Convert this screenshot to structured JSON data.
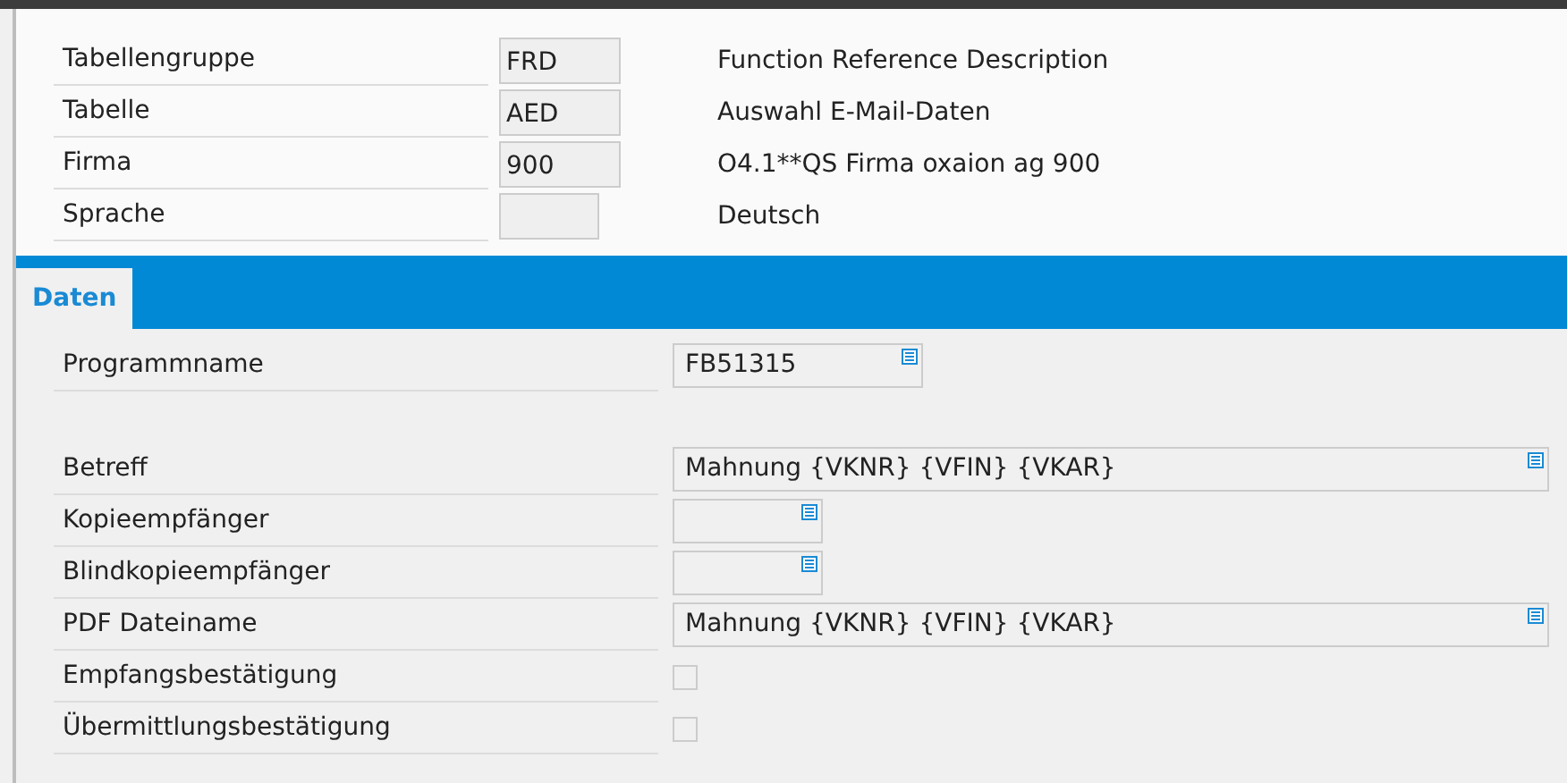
{
  "header_rows": [
    {
      "label": "Tabellengruppe",
      "code": "FRD",
      "description": "Function Reference Description"
    },
    {
      "label": "Tabelle",
      "code": "AED",
      "description": "Auswahl E-Mail-Daten"
    },
    {
      "label": "Firma",
      "code": "900",
      "description": "O4.1**QS Firma oxaion ag 900"
    },
    {
      "label": "Sprache",
      "description": "Deutsch"
    }
  ],
  "tabs": [
    {
      "label": "Daten",
      "selected": true
    }
  ],
  "field_groups": [
    [
      {
        "label": "Programmname",
        "kind": "field",
        "value": "FB51315"
      }
    ],
    [
      {
        "label": "Betreff",
        "kind": "longfield",
        "value": "Mahnung {VKNR} {VFIN} {VKAR}"
      },
      {
        "label": "Kopieempfänger",
        "kind": "shortfield"
      },
      {
        "label": "Blindkopieempfänger",
        "kind": "shortfield"
      },
      {
        "label": "PDF Dateiname",
        "kind": "longfield",
        "value": "Mahnung {VKNR} {VFIN} {VKAR}"
      },
      {
        "label": "Empfangsbestätigung",
        "kind": "checkbox",
        "checked": false
      },
      {
        "label": "Übermittlungsbestätigung",
        "kind": "checkbox",
        "checked": false
      }
    ]
  ]
}
